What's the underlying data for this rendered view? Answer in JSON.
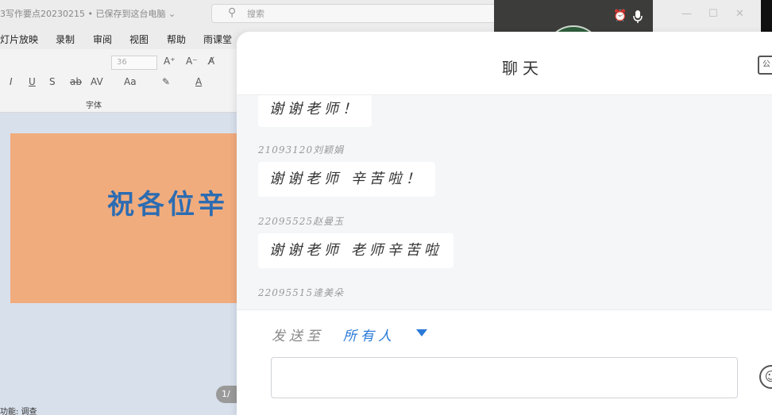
{
  "window": {
    "doc_title": "3写作要点20230215 • 已保存到这台电脑 ⌄",
    "search_placeholder": "搜索"
  },
  "ribbon": {
    "tabs": [
      "灯片放映",
      "录制",
      "审阅",
      "视图",
      "帮助",
      "雨课堂"
    ],
    "font_size": "36",
    "font_group_label": "字体"
  },
  "slide": {
    "text": "祝各位辛",
    "page": "1/"
  },
  "status_bar": "功能: 调查",
  "chat": {
    "title": "聊天",
    "header_icon_text": "公",
    "messages": [
      {
        "sender": "",
        "text": "谢谢老师！"
      },
      {
        "sender": "21093120刘颖娟",
        "text": "谢谢老师 辛苦啦！"
      },
      {
        "sender": "22095525赵曼玉",
        "text": "谢谢老师 老师辛苦啦"
      },
      {
        "sender": "22095515逄美朵",
        "text": ""
      }
    ],
    "composer": {
      "send_to_label": "发送至",
      "recipient": "所有人",
      "input_value": "",
      "input_placeholder": ""
    }
  },
  "colors": {
    "accent": "#2a7ad8",
    "slide_background": "#f1ac7d",
    "slide_text": "#2c6cb2"
  }
}
